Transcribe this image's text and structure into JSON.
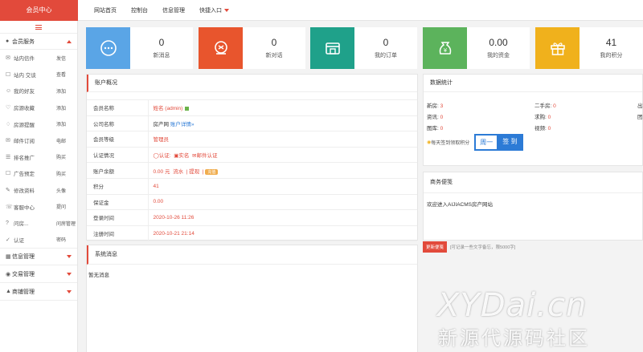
{
  "brand": "会员中心",
  "topnav": [
    "网站首页",
    "控制台",
    "信息管理",
    "快捷入口"
  ],
  "sidebar": {
    "sections": [
      {
        "label": "会员服务",
        "icon": "user-icon",
        "expanded": true
      },
      {
        "label": "信息管理",
        "icon": "grid-icon",
        "expanded": false
      },
      {
        "label": "交易管理",
        "icon": "money-bag-icon",
        "expanded": false
      },
      {
        "label": "商铺管理",
        "icon": "shop-icon",
        "expanded": false
      }
    ],
    "items": [
      {
        "label": "站内信件",
        "action": "发信",
        "icon": "mail-icon"
      },
      {
        "label": "站内 交谈",
        "action": "查看",
        "icon": "chat-icon"
      },
      {
        "label": "我的好友",
        "action": "添加",
        "icon": "friend-icon"
      },
      {
        "label": "房源收藏",
        "action": "添加",
        "icon": "heart-icon"
      },
      {
        "label": "房源提醒",
        "action": "添加",
        "icon": "bell-icon"
      },
      {
        "label": "邮件订阅",
        "action": "电邮",
        "icon": "envelope-icon"
      },
      {
        "label": "排名推广",
        "action": "购买",
        "icon": "rank-icon"
      },
      {
        "label": "广告预定",
        "action": "购买",
        "icon": "ad-icon"
      },
      {
        "label": "修改资料",
        "action": "头像",
        "icon": "edit-icon"
      },
      {
        "label": "客服中心",
        "action": "提问",
        "icon": "service-icon"
      },
      {
        "label": "问房...",
        "action": "问房管理",
        "icon": "question-icon"
      },
      {
        "label": "认证",
        "action": "密码",
        "icon": "cert-icon"
      }
    ]
  },
  "stats": [
    {
      "value": "0",
      "caption": "新消息",
      "color": "#5aa5e6",
      "icon": "message-icon"
    },
    {
      "value": "0",
      "caption": "新对话",
      "color": "#e8552d",
      "icon": "dialog-icon"
    },
    {
      "value": "0",
      "caption": "我的订单",
      "color": "#1fa18a",
      "icon": "store-icon"
    },
    {
      "value": "0.00",
      "caption": "我的资金",
      "color": "#5cb35c",
      "icon": "money-icon"
    },
    {
      "value": "41",
      "caption": "我的积分",
      "color": "#f0b11c",
      "icon": "gift-icon"
    }
  ],
  "account": {
    "title": "账户概况",
    "rows": [
      {
        "key": "会员名称",
        "value": "姓名 (admin)"
      },
      {
        "key": "公司名称",
        "value": "房产网",
        "link": "账户详情»"
      },
      {
        "key": "会员等级",
        "value": "管理员"
      },
      {
        "key": "认证情况",
        "parts": [
          "认证:",
          "实名",
          "邮件认证"
        ]
      },
      {
        "key": "账户余额",
        "value": "0.00 元",
        "links": [
          "流水",
          "提现"
        ],
        "badge": "充值"
      },
      {
        "key": "积分",
        "value": "41"
      },
      {
        "key": "保证金",
        "value": "0.00"
      },
      {
        "key": "登录时间",
        "value": "2020-10-26 11:26"
      },
      {
        "key": "注册时间",
        "value": "2020-10-21 21:14"
      }
    ]
  },
  "messages": {
    "title": "系统消息",
    "empty": "暂无消息"
  },
  "datastats": {
    "title": "数据统计",
    "cells": [
      {
        "label": "新房:",
        "value": "3"
      },
      {
        "label": "二手房:",
        "value": "0"
      },
      {
        "label": "出",
        "value": ""
      },
      {
        "label": "资讯:",
        "value": "0"
      },
      {
        "label": "求购:",
        "value": "0"
      },
      {
        "label": "团",
        "value": ""
      },
      {
        "label": "图库:",
        "value": "0"
      },
      {
        "label": "视频:",
        "value": "0"
      }
    ],
    "sign_hint": "每天签到领取积分",
    "sign_day": "周一",
    "sign_btn": "签 到"
  },
  "memo": {
    "title": "商务便笺",
    "text": "欢迎进入AIJIACMS房产网站",
    "btn": "更新便笺",
    "hint": "[可记录一些文字备忘，限5000字]"
  },
  "watermark": {
    "line1": "XYDai.cn",
    "line2": "新源代源码社区"
  }
}
